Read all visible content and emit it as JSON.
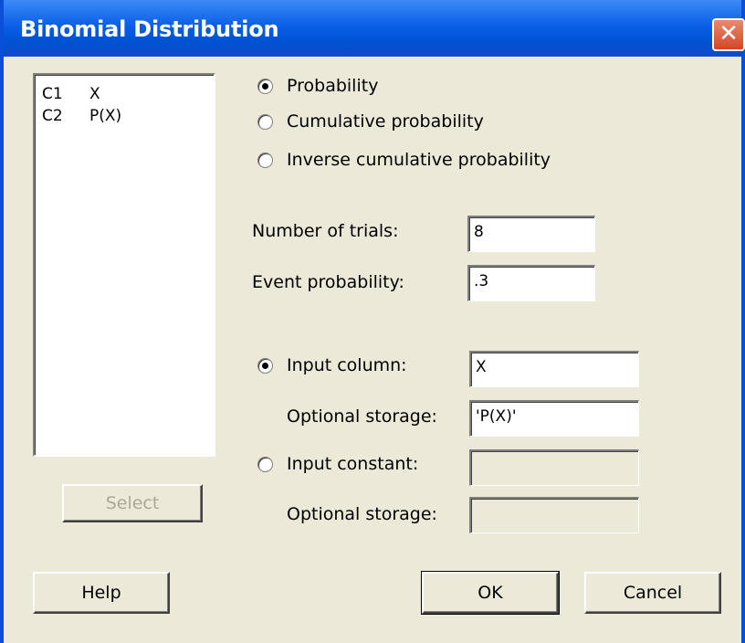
{
  "window": {
    "title": "Binomial Distribution",
    "close_glyph": "✕"
  },
  "columns": [
    {
      "id": "C1",
      "name": "X"
    },
    {
      "id": "C2",
      "name": "P(X)"
    }
  ],
  "select_button": "Select",
  "mode": {
    "selected": "Probability",
    "options": [
      "Probability",
      "Cumulative probability",
      "Inverse cumulative probability"
    ]
  },
  "trials": {
    "label": "Number of trials:",
    "value": "8"
  },
  "event_prob": {
    "label": "Event probability:",
    "value": ".3"
  },
  "input_column": {
    "label": "Input column:",
    "value": "X",
    "storage_label": "Optional storage:",
    "storage_value": "'P(X)'"
  },
  "input_constant": {
    "label": "Input constant:",
    "value": "",
    "storage_label": "Optional storage:",
    "storage_value": ""
  },
  "buttons": {
    "help": "Help",
    "ok": "OK",
    "cancel": "Cancel"
  },
  "colors": {
    "titlebar": "#0a5fe6",
    "dialog_bg": "#ece9d8",
    "close": "#d5452b"
  }
}
